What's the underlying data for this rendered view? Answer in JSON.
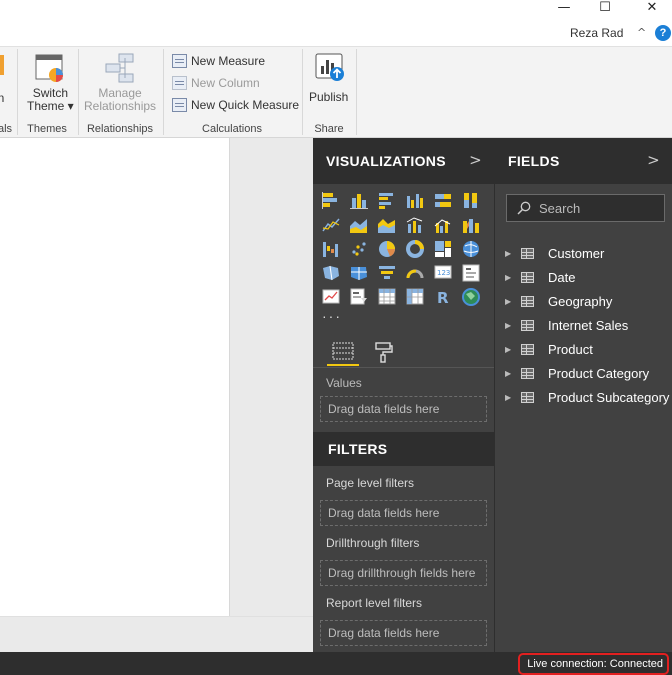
{
  "window": {
    "user_name": "Reza Rad",
    "controls": {
      "minimize": "—",
      "maximize": "☐",
      "close": "✕"
    },
    "help": "?"
  },
  "ribbon": {
    "groups": [
      {
        "label": "als",
        "partial_button": "n"
      },
      {
        "label": "Themes",
        "switch_theme": [
          "Switch",
          "Theme ▾"
        ]
      },
      {
        "label": "Relationships",
        "manage": [
          "Manage",
          "Relationships"
        ]
      },
      {
        "label": "Calculations",
        "new_measure": "New Measure",
        "new_column": "New Column",
        "new_quick_measure": "New Quick Measure"
      },
      {
        "label": "Share",
        "publish": "Publish"
      }
    ]
  },
  "visualizations": {
    "title": "VISUALIZATIONS",
    "ellipsis": "···",
    "values_label": "Values",
    "values_drop": "Drag data fields here",
    "filters": {
      "title": "FILTERS",
      "page_label": "Page level filters",
      "page_drop": "Drag data fields here",
      "drillthrough_label": "Drillthrough filters",
      "drillthrough_drop": "Drag drillthrough fields here",
      "report_label": "Report level filters",
      "report_drop": "Drag data fields here"
    }
  },
  "fields": {
    "title": "FIELDS",
    "search_placeholder": "Search",
    "tables": [
      "Customer",
      "Date",
      "Geography",
      "Internet Sales",
      "Product",
      "Product Category",
      "Product Subcategory"
    ]
  },
  "status": {
    "connection": "Live connection: Connected"
  },
  "colors": {
    "accent_yellow": "#f2c811",
    "pane_bg": "#414141",
    "pane_header": "#2e2e2e",
    "status_highlight": "#e22020",
    "help_blue": "#1b7fd6"
  }
}
